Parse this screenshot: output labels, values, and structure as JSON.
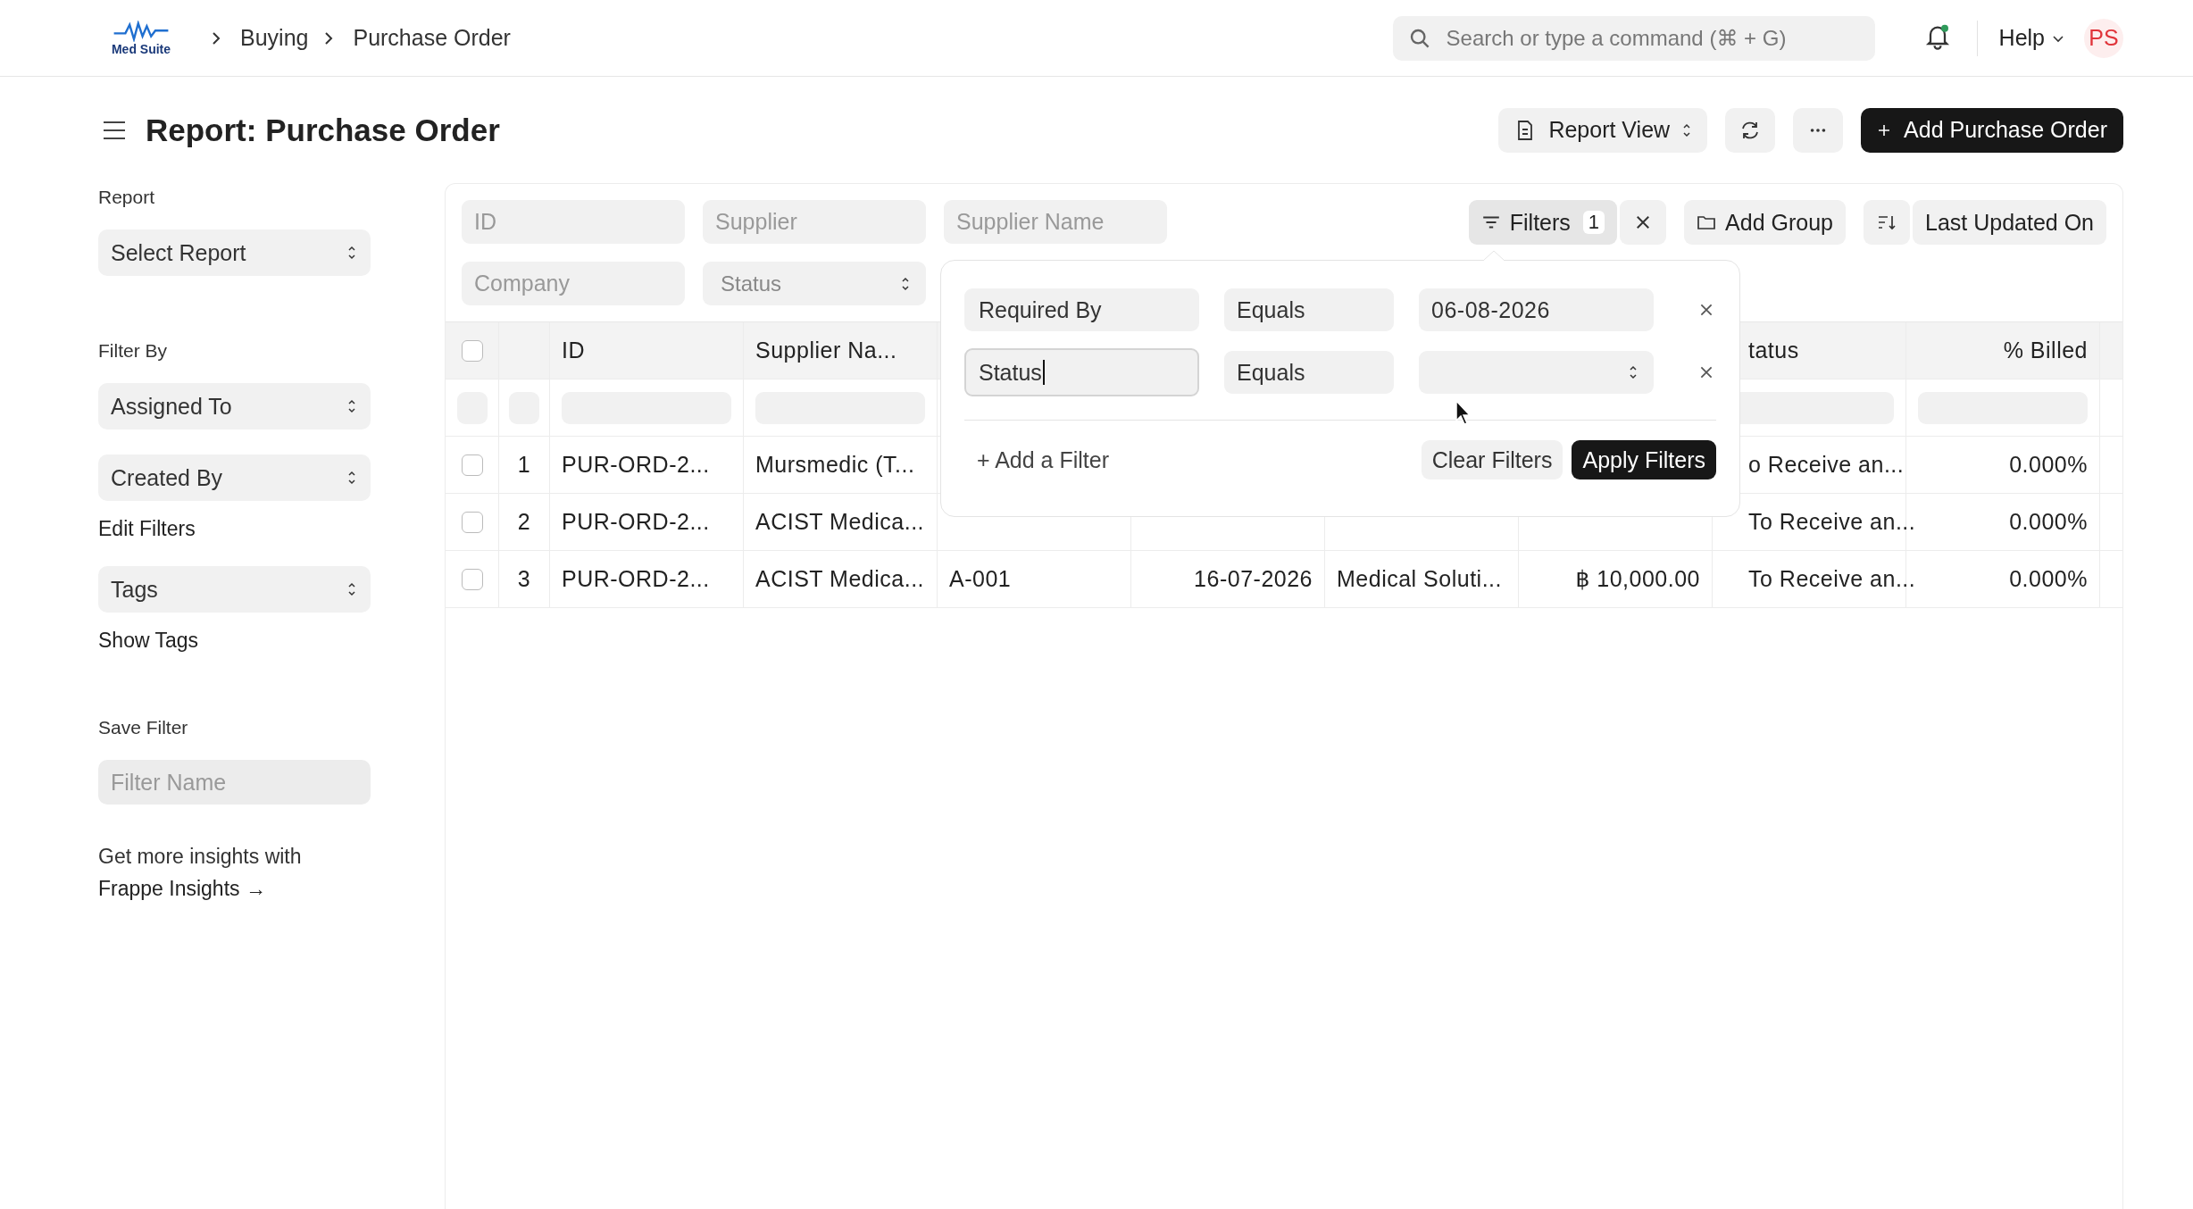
{
  "topbar": {
    "logo": "Med Suite",
    "breadcrumbs": [
      "Buying",
      "Purchase Order"
    ],
    "search": {
      "placeholder": "Search or type a command (⌘ + G)"
    },
    "notifications": {
      "unread": true
    },
    "help": "Help",
    "avatar": "PS"
  },
  "page": {
    "title": "Report: Purchase Order",
    "view": "Report View",
    "primary": "Add Purchase Order"
  },
  "sidebar": {
    "sections": [
      {
        "label": "Report",
        "controls": [
          {
            "kind": "select",
            "text": "Select Report"
          }
        ]
      },
      {
        "label": "Filter By",
        "controls": [
          {
            "kind": "select",
            "text": "Assigned To"
          },
          {
            "kind": "select",
            "text": "Created By"
          },
          {
            "kind": "link",
            "text": "Edit Filters"
          },
          {
            "kind": "select",
            "text": "Tags"
          },
          {
            "kind": "link",
            "text": "Show Tags"
          }
        ]
      },
      {
        "label": "Save Filter",
        "controls": [
          {
            "kind": "input",
            "placeholder": "Filter Name"
          }
        ]
      }
    ],
    "promo": {
      "text": "Get more insights with",
      "link": "Frappe Insights →"
    }
  },
  "standard_filters": [
    {
      "kind": "input",
      "placeholder": "ID"
    },
    {
      "kind": "input",
      "placeholder": "Supplier"
    },
    {
      "kind": "input",
      "placeholder": "Supplier Name"
    },
    {
      "kind": "input",
      "placeholder": "Company"
    },
    {
      "kind": "select",
      "placeholder": "Status"
    }
  ],
  "toolbar": {
    "filters": {
      "label": "Filters",
      "count": "1"
    },
    "group": "Add Group",
    "sort": "Last Updated On"
  },
  "table": {
    "header": {
      "checked": false,
      "id": "ID",
      "supplier_name": "Supplier Na...",
      "status": "tatus",
      "billed": "% Billed"
    },
    "rows": [
      {
        "checked": false,
        "index": "1",
        "id": "PUR-ORD-2...",
        "supplier_name": "Mursmedic (T...",
        "status": "o Receive an...",
        "billed": "0.000%"
      },
      {
        "checked": false,
        "index": "2",
        "id": "PUR-ORD-2...",
        "supplier_name": "ACIST Medica...",
        "status": "To Receive an...",
        "billed": "0.000%"
      },
      {
        "checked": false,
        "index": "3",
        "id": "PUR-ORD-2...",
        "supplier_name": "ACIST Medica...",
        "column_5": "A-001",
        "column_6": "16-07-2026",
        "column_7": "Medical Soluti...",
        "column_8": "฿ 10,000.00",
        "status": "To Receive an...",
        "billed": "0.000%"
      }
    ]
  },
  "filter_popup": {
    "rows": [
      {
        "field": "Required By",
        "condition": "Equals",
        "kind": "input",
        "value": "06-08-2026",
        "focused": false
      },
      {
        "field": "Status",
        "condition": "Equals",
        "kind": "select",
        "focused": true
      }
    ],
    "add": "+ Add a Filter",
    "clear": "Clear Filters",
    "apply": "Apply Filters"
  }
}
